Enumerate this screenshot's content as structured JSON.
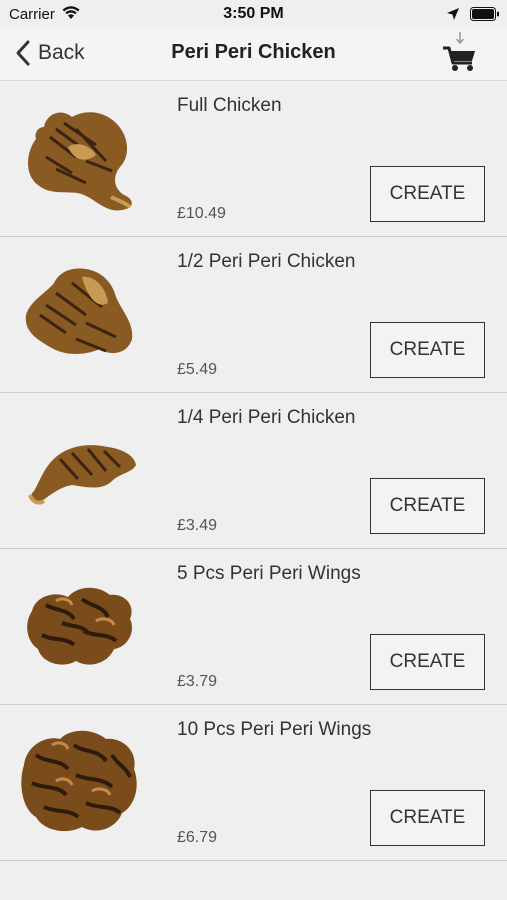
{
  "status_bar": {
    "carrier": "Carrier",
    "time": "3:50 PM"
  },
  "nav": {
    "back_label": "Back",
    "title": "Peri Peri Chicken"
  },
  "items": [
    {
      "name": "Full Chicken",
      "price": "£10.49",
      "button": "CREATE"
    },
    {
      "name": "1/2 Peri Peri Chicken",
      "price": "£5.49",
      "button": "CREATE"
    },
    {
      "name": "1/4 Peri Peri Chicken",
      "price": "£3.49",
      "button": "CREATE"
    },
    {
      "name": "5 Pcs Peri Peri Wings",
      "price": "£3.79",
      "button": "CREATE"
    },
    {
      "name": "10 Pcs Peri Peri Wings",
      "price": "£6.79",
      "button": "CREATE"
    }
  ],
  "colors": {
    "chicken_brown": "#8a5a23",
    "char": "#3b2410"
  }
}
